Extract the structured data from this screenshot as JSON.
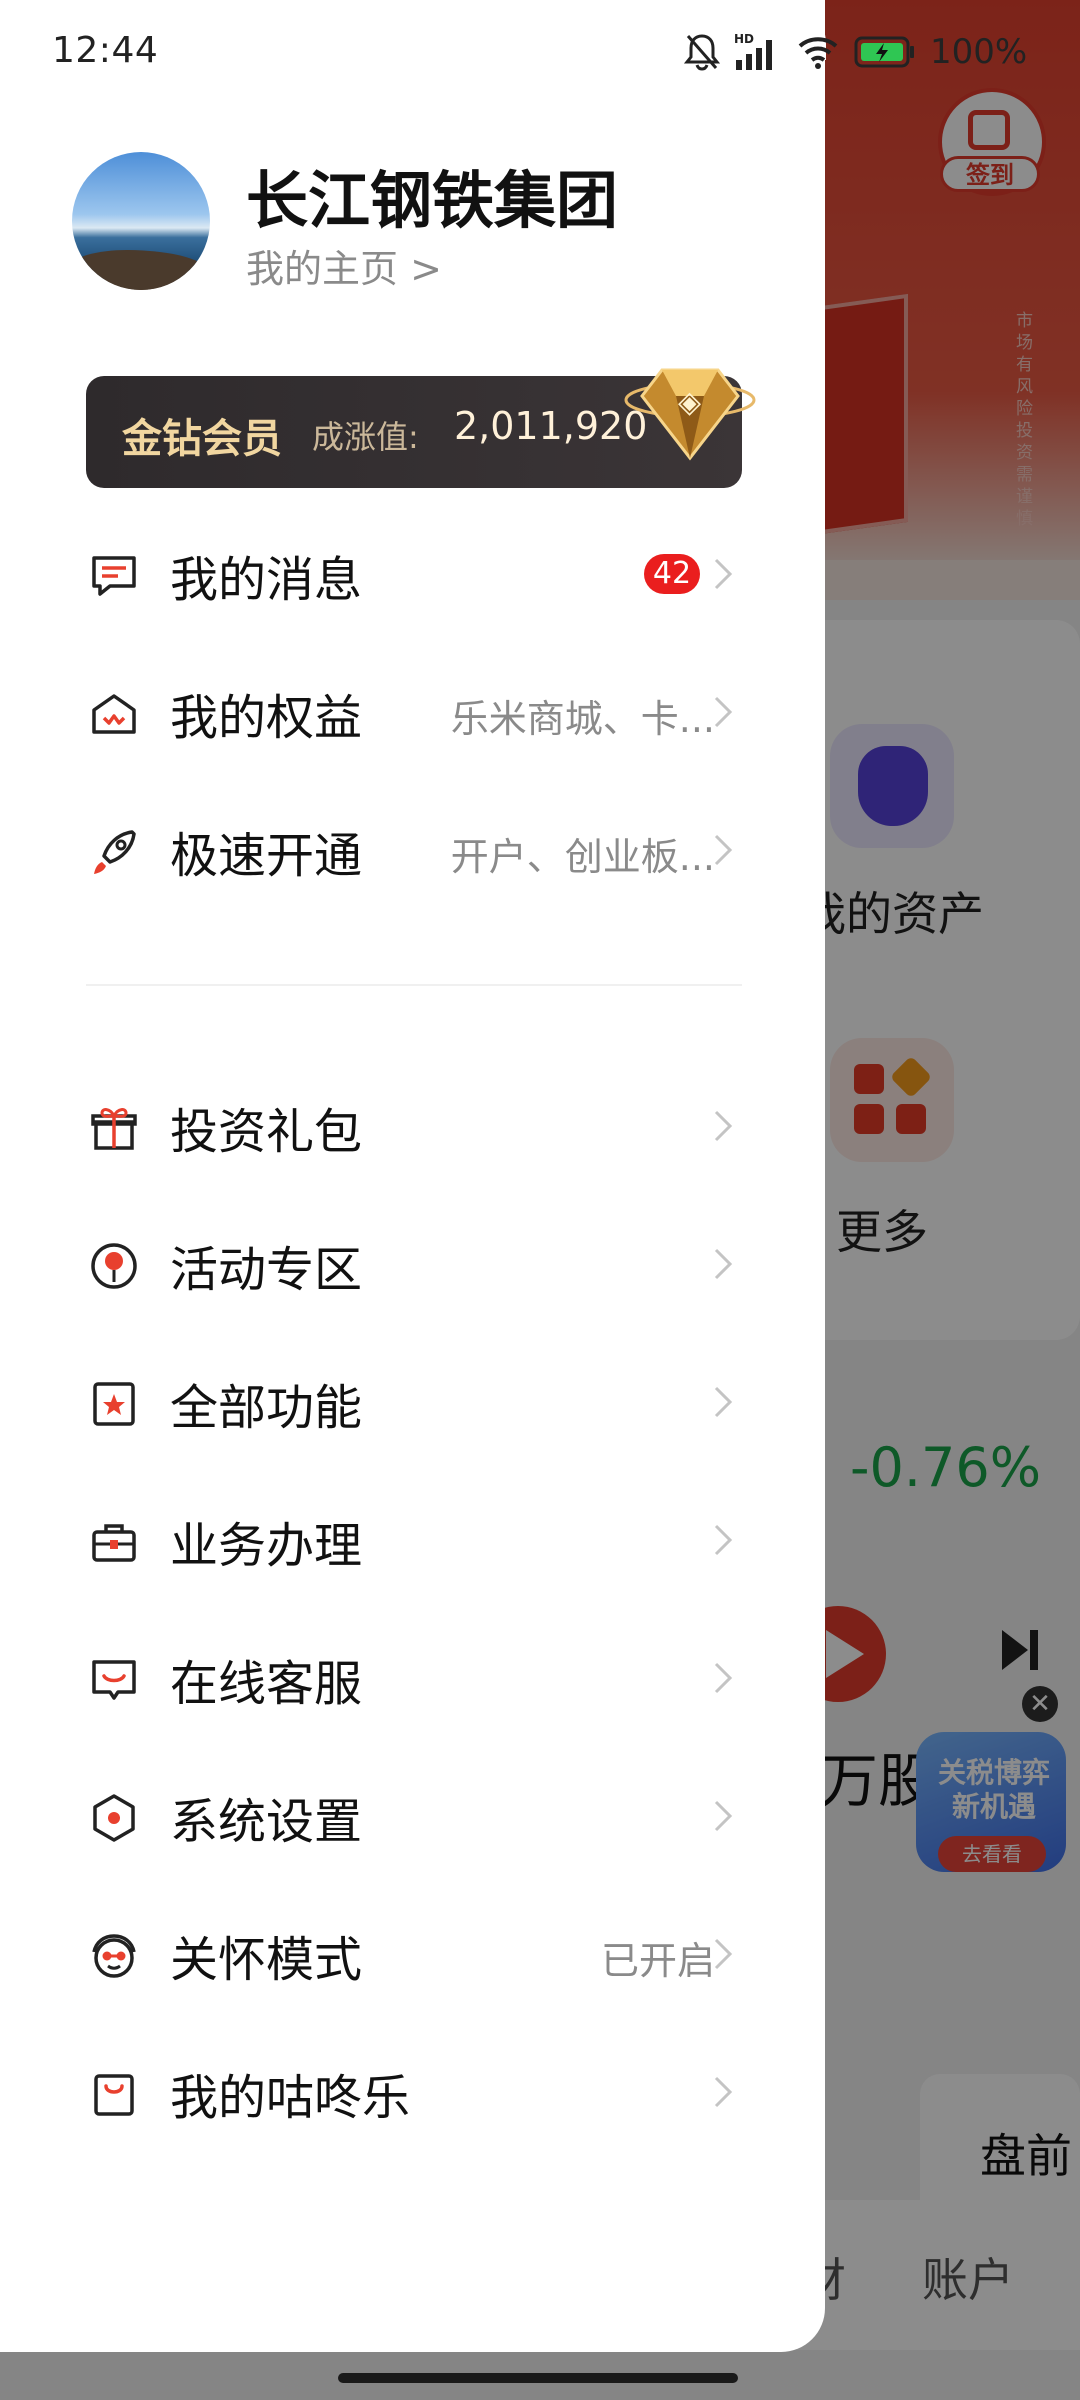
{
  "status_bar": {
    "time": "12:44",
    "network_label": "HD",
    "battery": "100%"
  },
  "profile": {
    "name": "长江钢铁集团",
    "home_link": "我的主页 >"
  },
  "vip": {
    "title": "金钻会员",
    "growth_label": "成涨值:",
    "growth_value": "2,011,920"
  },
  "menu_top": [
    {
      "label": "我的消息",
      "badge": "42",
      "sub": ""
    },
    {
      "label": "我的权益",
      "sub": "乐米商城、卡..."
    },
    {
      "label": "极速开通",
      "sub": "开户、创业板..."
    }
  ],
  "menu_bottom": [
    {
      "label": "投资礼包",
      "sub": ""
    },
    {
      "label": "活动专区",
      "sub": ""
    },
    {
      "label": "全部功能",
      "sub": ""
    },
    {
      "label": "业务办理",
      "sub": ""
    },
    {
      "label": "在线客服",
      "sub": ""
    },
    {
      "label": "系统设置",
      "sub": ""
    },
    {
      "label": "关怀模式",
      "sub": "已开启"
    },
    {
      "label": "我的咕咚乐",
      "sub": ""
    }
  ],
  "background": {
    "signin_label": "签到",
    "risk_notice": "市场有风险 投资需谨慎",
    "asset_label": "我的资产",
    "more_label": "更多",
    "index_change": "-0.76%",
    "stock_text": "万股",
    "float_banner_text": "关税博弈 新机遇",
    "float_banner_button": "去看看",
    "premarket_label": "盘前",
    "tab_wealth": "财",
    "tab_account": "账户"
  },
  "icons": {
    "accent_color": "#e8402e",
    "message": "message-icon",
    "rights": "crown-house-icon",
    "rocket": "rocket-icon",
    "gift": "gift-icon",
    "activity": "balloon-icon",
    "all_functions": "grid-star-icon",
    "business": "briefcase-icon",
    "service": "chat-support-icon",
    "settings": "hexagon-settings-icon",
    "care": "care-mode-icon",
    "gudongle": "shopping-bag-icon"
  }
}
